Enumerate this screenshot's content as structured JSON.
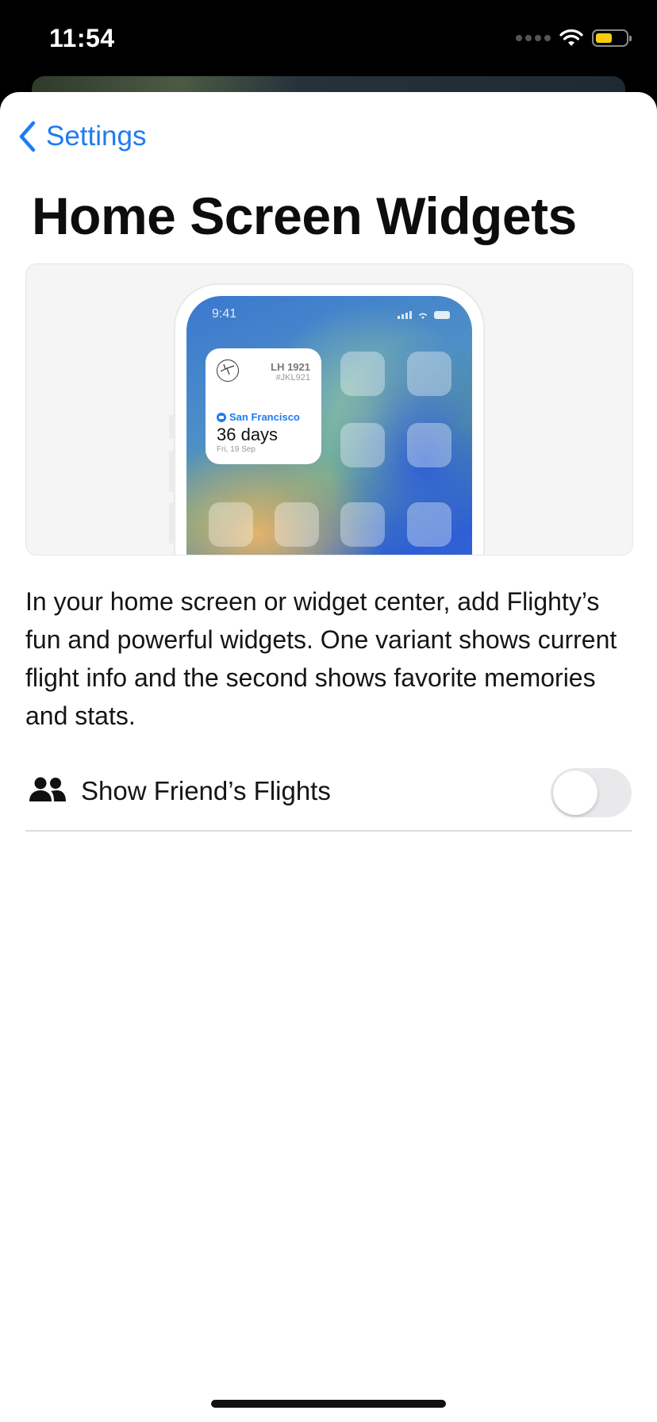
{
  "status_bar": {
    "time": "11:54",
    "battery_color": "#f6cc0c"
  },
  "nav": {
    "back_label": "Settings"
  },
  "page": {
    "title": "Home Screen Widgets",
    "description": "In your home screen or widget center, add Flighty’s fun and powerful widgets. One variant shows current flight info and the second shows favorite memories and stats."
  },
  "preview": {
    "screen_time": "9:41",
    "widget": {
      "flight_number": "LH 1921",
      "booking_ref": "#JKL921",
      "destination": "San Francisco",
      "countdown": "36 days",
      "date": "Fri, 19 Sep"
    }
  },
  "settings": {
    "show_friends_flights": {
      "label": "Show Friend’s Flights",
      "enabled": false,
      "icon": "people-icon"
    }
  },
  "colors": {
    "accent": "#1e7cf2",
    "toggle_off": "#e9e9eb"
  }
}
